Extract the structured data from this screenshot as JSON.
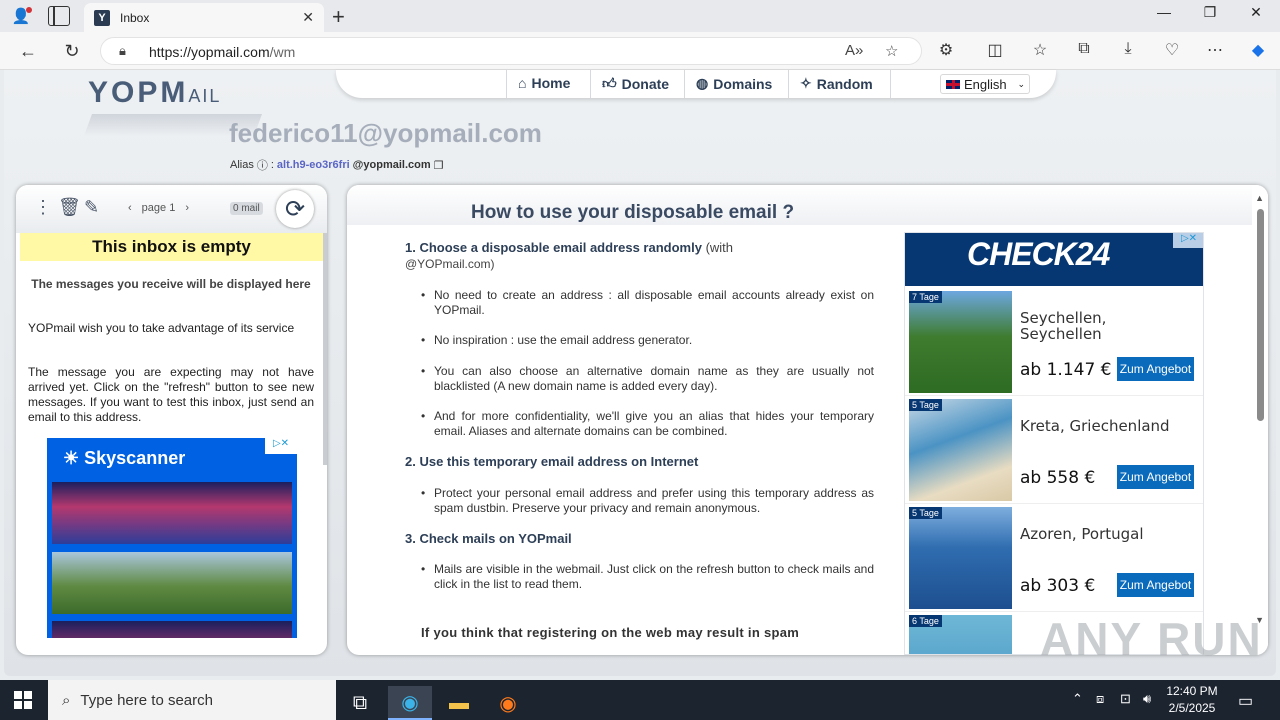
{
  "browser": {
    "tab_title": "Inbox",
    "tab_favicon": "Y",
    "url_domain": "https://yopmail.com",
    "url_path": "/wm"
  },
  "site": {
    "logo_main": "YOPM",
    "logo_tail": "AIL",
    "nav": {
      "home": "Home",
      "donate": "Donate",
      "domains": "Domains",
      "random": "Random"
    },
    "language": "English"
  },
  "account": {
    "email": "federico11@yopmail.com",
    "alias_label": "Alias",
    "alias_value": "alt.h9-eo3r6fri",
    "alias_domain": "@yopmail.com"
  },
  "inbox": {
    "page_label": "page 1",
    "mail_count": "0 mail",
    "empty_banner": "This inbox is empty",
    "msg1": "The messages you receive will be displayed here",
    "msg2": "YOPmail wish you to take advantage of its service",
    "msg3": "The message you are expecting may not have arrived yet. Click on the \"refresh\" button to see new messages. If you want to test this inbox, just send an email to this address."
  },
  "ads": {
    "skyscanner_name": "Skyscanner",
    "check24_name": "CHECK24",
    "offers": [
      {
        "tag": "7 Tage",
        "name": "Seychellen, Seychellen",
        "price": "ab 1.147 €",
        "button": "Zum Angebot"
      },
      {
        "tag": "5 Tage",
        "name": "Kreta, Griechenland",
        "price": "ab 558 €",
        "button": "Zum Angebot"
      },
      {
        "tag": "5 Tage",
        "name": "Azoren, Portugal",
        "price": "ab 303 €",
        "button": "Zum Angebot"
      },
      {
        "tag": "6 Tage"
      }
    ]
  },
  "help": {
    "title": "How to use your disposable email ?",
    "step1": "1. Choose a disposable email address randomly",
    "step1_light": "(with",
    "step1_cont": "@YOPmail.com)",
    "b1": "No need to create an address : all disposable email accounts already exist on YOPmail.",
    "b2": "No inspiration : use the email address generator.",
    "b3": "You can also choose an alternative domain name as they are usually not blacklisted (A new domain name is added every day).",
    "b4": "And for more confidentiality, we'll give you an alias that hides your temporary email. Aliases and alternate domains can be combined.",
    "step2": "2. Use this temporary email address on Internet",
    "b5": "Protect your personal email address and prefer using this temporary address as spam dustbin. Preserve your privacy and remain anonymous.",
    "step3": "3. Check mails on YOPmail",
    "b6": "Mails are visible in the webmail. Just click on the refresh button to check mails and click in the list to read them.",
    "cut_text": "If you think that registering on the web may result in spam"
  },
  "watermark": "ANY RUN",
  "taskbar": {
    "search_placeholder": "Type here to search",
    "time": "12:40 PM",
    "date": "2/5/2025"
  }
}
